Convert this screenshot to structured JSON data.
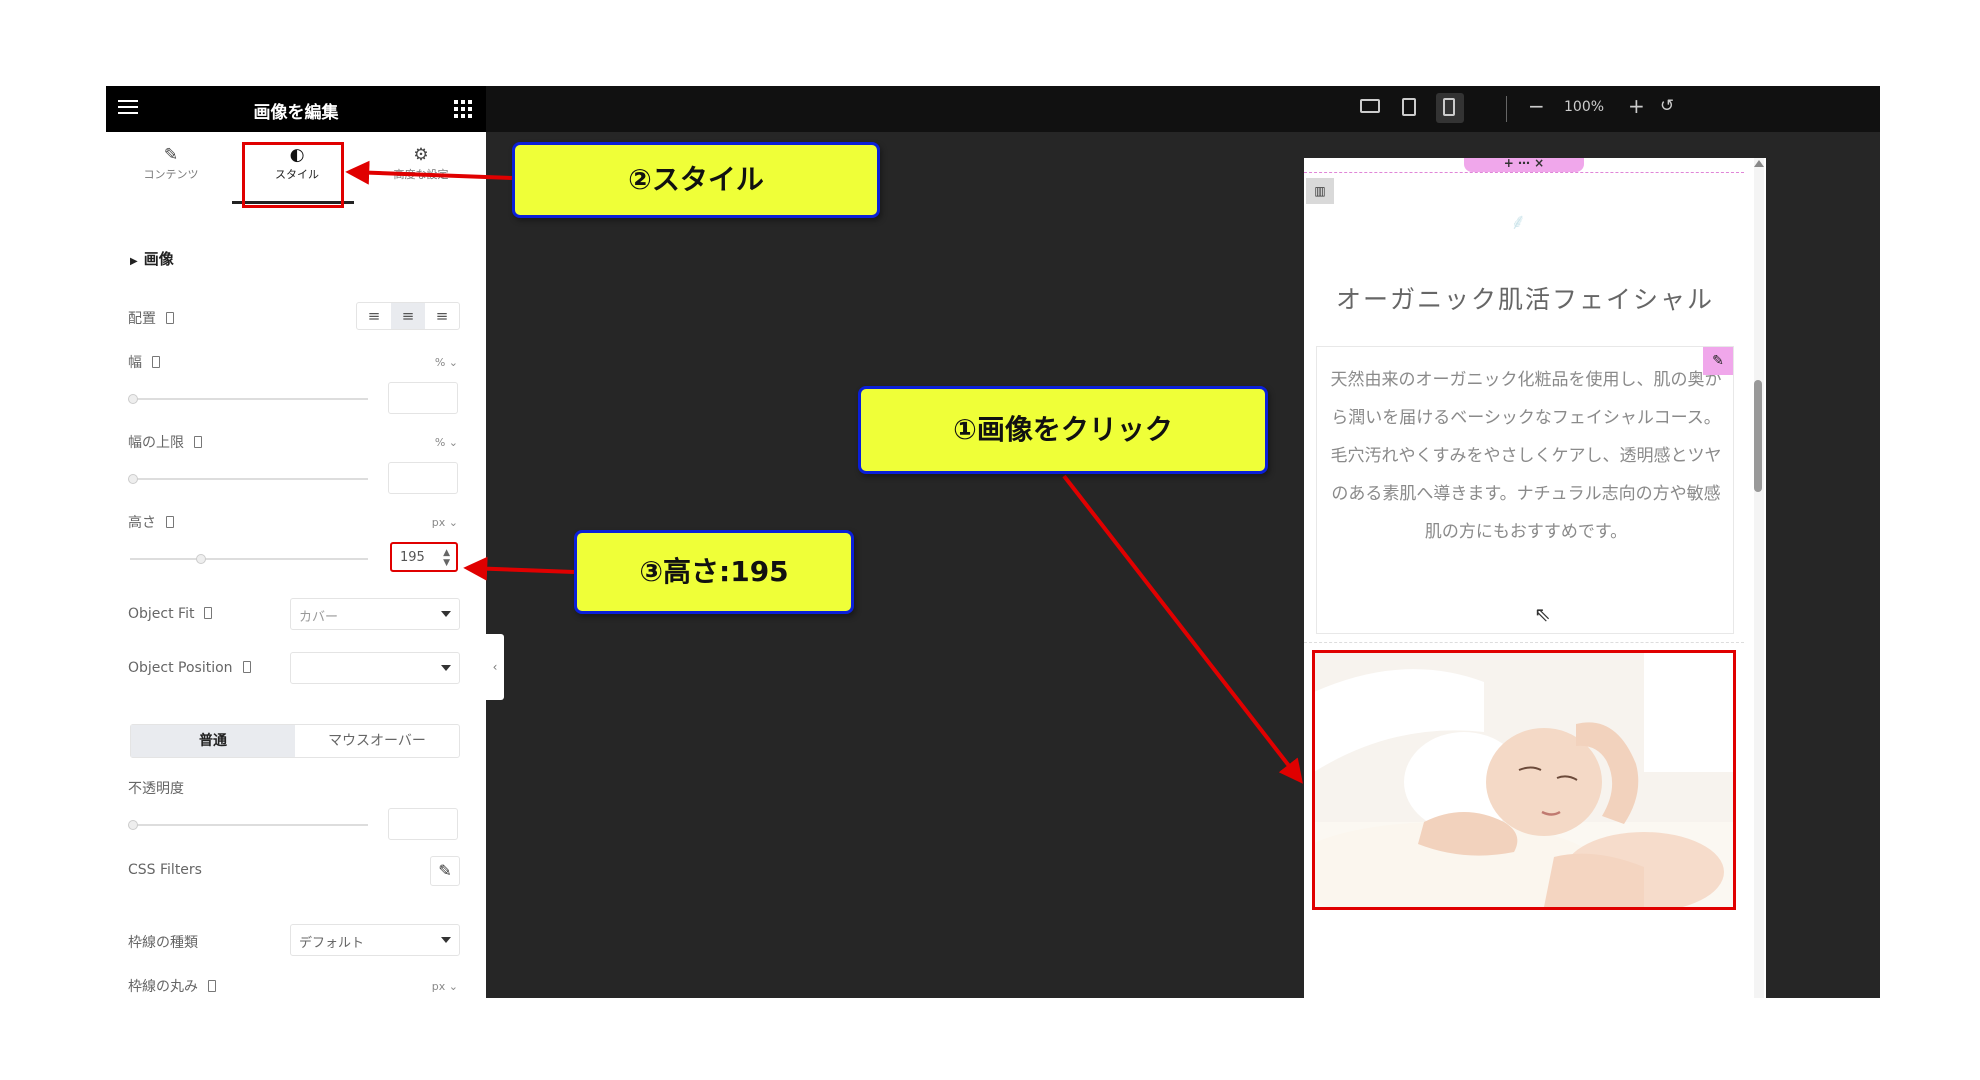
{
  "panel": {
    "title": "画像を編集",
    "tabs": [
      {
        "label": "コンテンツ",
        "icon": "pencil-icon"
      },
      {
        "label": "スタイル",
        "icon": "half-circle-icon"
      },
      {
        "label": "高度な設定",
        "icon": "gear-icon"
      }
    ],
    "section_title": "画像",
    "fields": {
      "align_label": "配置",
      "width_label": "幅",
      "width_unit": "% ⌄",
      "max_width_label": "幅の上限",
      "max_width_unit": "% ⌄",
      "height_label": "高さ",
      "height_unit": "px ⌄",
      "height_value": "195",
      "height_slider_level": 0.3,
      "object_fit_label": "Object Fit",
      "object_fit_value": "カバー",
      "object_position_label": "Object Position",
      "object_position_value": "",
      "state_normal": "普通",
      "state_hover": "マウスオーバー",
      "opacity_label": "不透明度",
      "css_filters_label": "CSS Filters",
      "border_type_label": "枠線の種類",
      "border_type_value": "デフォルト",
      "border_radius_label": "枠線の丸み",
      "border_radius_unit": "px ⌄"
    }
  },
  "topbar": {
    "zoom": "100%",
    "devices": [
      "desktop-icon",
      "tablet-icon",
      "mobile-icon"
    ],
    "active_device": "mobile-icon"
  },
  "preview": {
    "heading": "オーガニック肌活フェイシャル",
    "body": "天然由来のオーガニック化粧品を使用し、肌の奥から潤いを届けるベーシックなフェイシャルコース。毛穴汚れやくすみをやさしくケアし、透明感とツヤのある素肌へ導きます。ナチュラル志向の方や敏感肌の方にもおすすめです。",
    "handle_icons": "+ ⋯ ×"
  },
  "annotations": {
    "step1": "①画像をクリック",
    "step2": "②スタイル",
    "step3": "③高さ:195",
    "highlight_color": "#e00000",
    "callout_fill": "#efff38",
    "callout_border": "#0a1fd8"
  }
}
